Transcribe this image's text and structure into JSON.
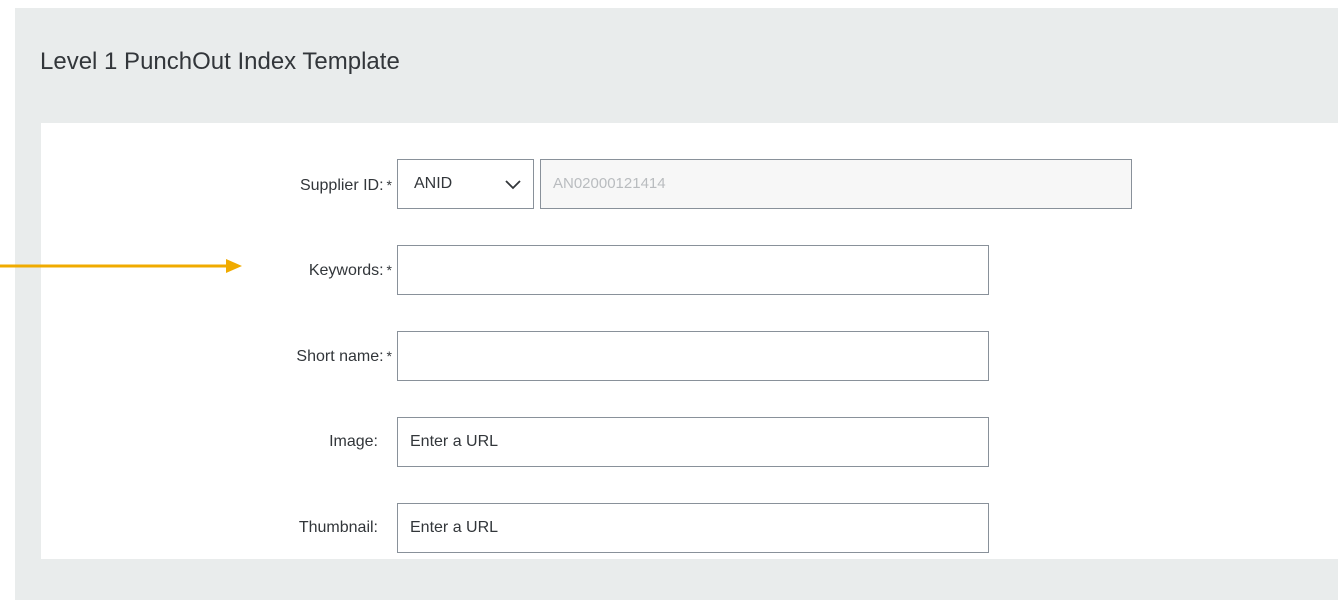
{
  "panel": {
    "title": "Level 1 PunchOut Index Template"
  },
  "form": {
    "required_marker": "*",
    "supplier_id": {
      "label": "Supplier ID:",
      "type_select": "ANID",
      "value": "AN02000121414"
    },
    "keywords": {
      "label": "Keywords:",
      "value": ""
    },
    "short_name": {
      "label": "Short name:",
      "value": ""
    },
    "image": {
      "label": "Image:",
      "placeholder": "Enter a URL"
    },
    "thumbnail": {
      "label": "Thumbnail:",
      "placeholder": "Enter a URL"
    }
  },
  "annotation": {
    "arrow_color": "#f0ab00",
    "icon": "arrow-right-icon"
  },
  "colors": {
    "panel_bg": "#e9ecec",
    "field_border": "#89919a",
    "text": "#32363a"
  }
}
